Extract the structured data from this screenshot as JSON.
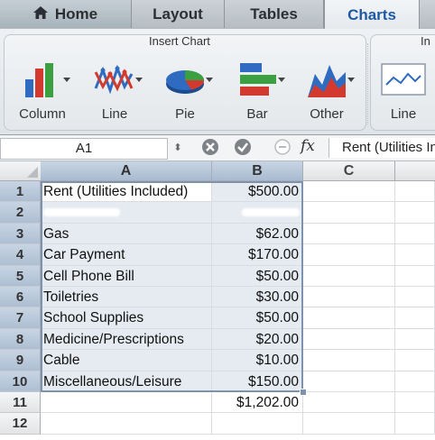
{
  "tabs": [
    {
      "label": "Home"
    },
    {
      "label": "Layout"
    },
    {
      "label": "Tables"
    },
    {
      "label": "Charts"
    }
  ],
  "ribbon": {
    "group_title": "Insert Chart",
    "group2_title": "In",
    "buttons": [
      {
        "label": "Column",
        "icon": "column-chart-icon"
      },
      {
        "label": "Line",
        "icon": "line-chart-icon"
      },
      {
        "label": "Pie",
        "icon": "pie-chart-icon"
      },
      {
        "label": "Bar",
        "icon": "bar-chart-icon"
      },
      {
        "label": "Other",
        "icon": "area-chart-icon"
      }
    ],
    "sparkline_button": {
      "label": "Line",
      "icon": "sparkline-icon"
    }
  },
  "formula_bar": {
    "name_box": "A1",
    "formula": "Rent (Utilities Included)"
  },
  "grid": {
    "columns": [
      "A",
      "B",
      "C"
    ],
    "rows": [
      {
        "num": "1",
        "a": "Rent (Utilities Included)",
        "b": "$500.00"
      },
      {
        "num": "2",
        "a": "",
        "b": ""
      },
      {
        "num": "3",
        "a": "Gas",
        "b": "$62.00"
      },
      {
        "num": "4",
        "a": "Car Payment",
        "b": "$170.00"
      },
      {
        "num": "5",
        "a": "Cell Phone Bill",
        "b": "$50.00"
      },
      {
        "num": "6",
        "a": "Toiletries",
        "b": "$30.00"
      },
      {
        "num": "7",
        "a": "School Supplies",
        "b": "$50.00"
      },
      {
        "num": "8",
        "a": "Medicine/Prescriptions",
        "b": "$20.00"
      },
      {
        "num": "9",
        "a": "Cable",
        "b": "$10.00"
      },
      {
        "num": "10",
        "a": "Miscellaneous/Leisure",
        "b": "$150.00"
      },
      {
        "num": "11",
        "a": "",
        "b": "$1,202.00"
      },
      {
        "num": "12",
        "a": "",
        "b": ""
      }
    ]
  }
}
